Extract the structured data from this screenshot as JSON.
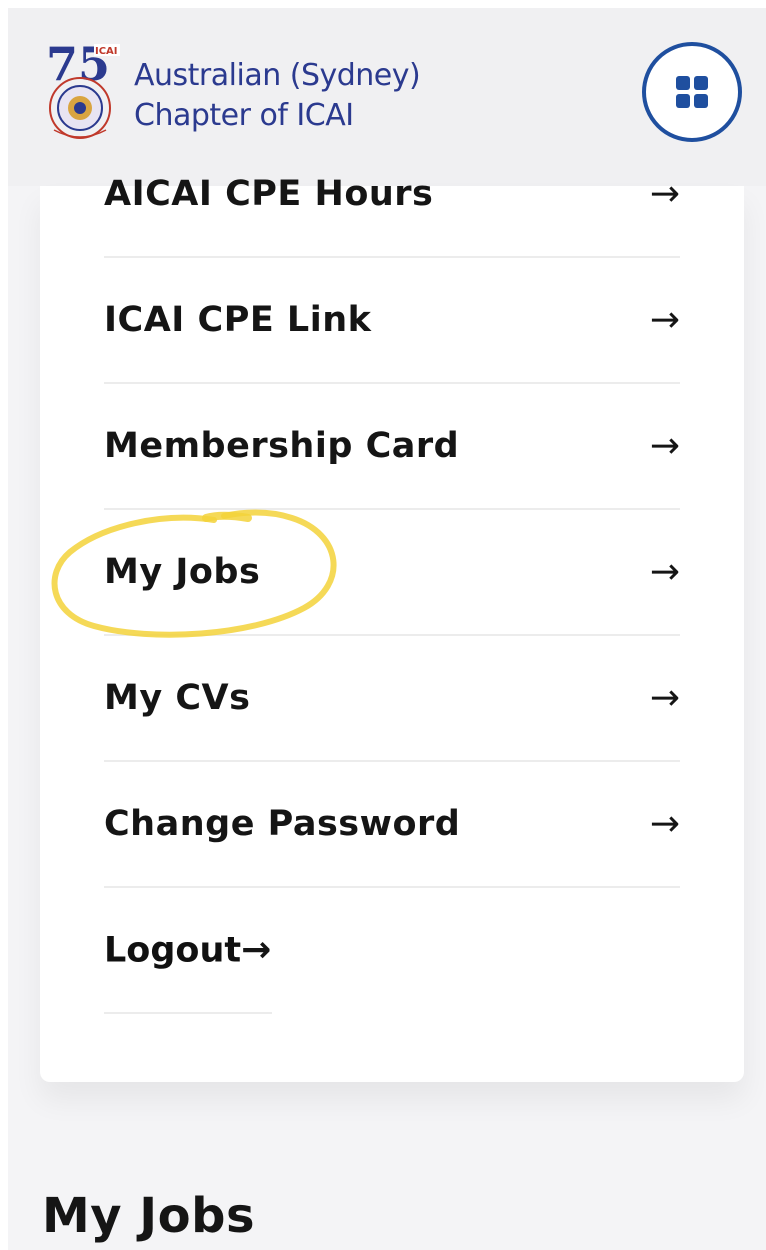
{
  "header": {
    "logo_badge": "ICAI",
    "logo_numeral": "75",
    "brand_line1": "Australian (Sydney)",
    "brand_line2": "Chapter of ICAI",
    "menu_icon": "grid-icon"
  },
  "menu": {
    "arrow_glyph": "→",
    "items": [
      {
        "label": "AICAI CPE Hours"
      },
      {
        "label": "ICAI CPE Link"
      },
      {
        "label": "Membership Card"
      },
      {
        "label": "My Jobs"
      },
      {
        "label": "My CVs"
      },
      {
        "label": "Change Password"
      },
      {
        "label": "Logout"
      }
    ]
  },
  "section": {
    "title": "My Jobs"
  },
  "colors": {
    "brand_blue": "#2b3a8f",
    "toggle_blue": "#1f4f9f",
    "highlight_yellow": "#f3d23a"
  }
}
